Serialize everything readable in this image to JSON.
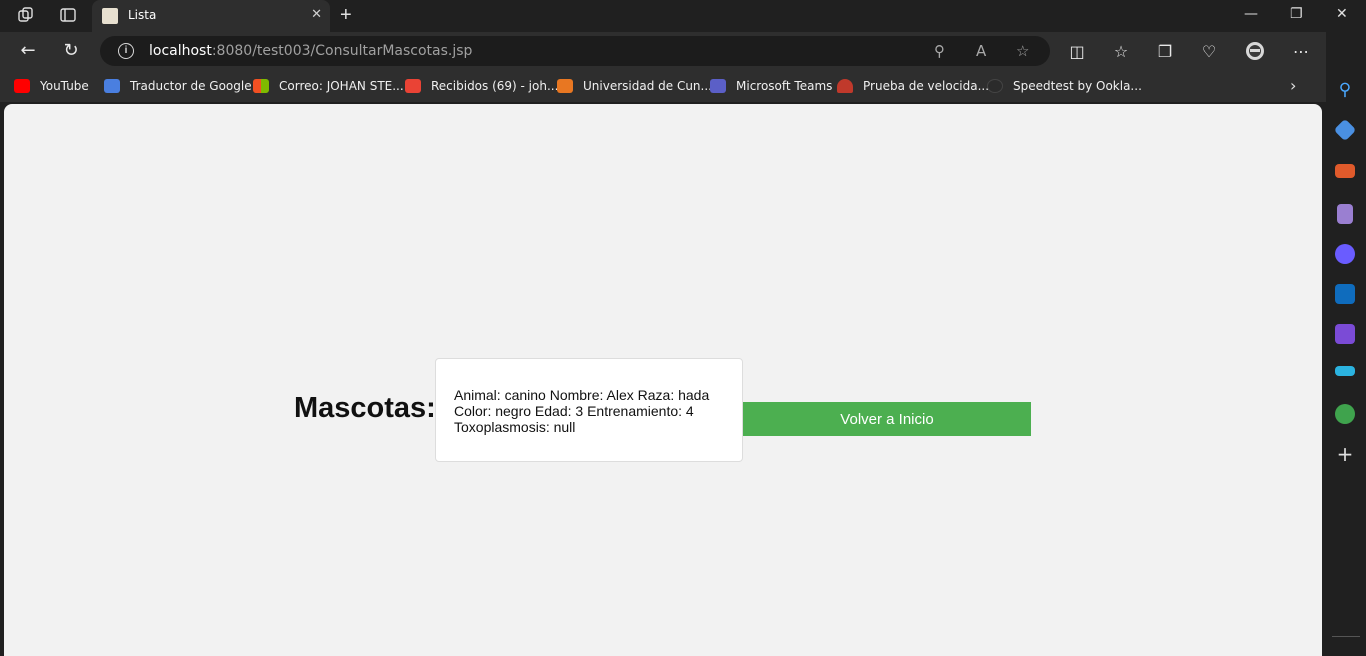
{
  "browser": {
    "tab": {
      "title": "Lista",
      "close": "✕"
    },
    "new_tab": "+",
    "window_controls": {
      "minimize": "—",
      "restore": "❐",
      "close": "✕"
    },
    "address": {
      "host": "localhost",
      "rest": ":8080/test003/ConsultarMascotas.jsp"
    },
    "bookmarks": [
      {
        "label": "YouTube",
        "color": "#ff0000"
      },
      {
        "label": "Traductor de Google",
        "color": "#4a7fe0"
      },
      {
        "label": "Correo: JOHAN STE...",
        "color": "#f25022"
      },
      {
        "label": "Recibidos (69) - joh...",
        "color": "#ea4335"
      },
      {
        "label": "Universidad de Cun...",
        "color": "#e87722"
      },
      {
        "label": "Microsoft Teams",
        "color": "#5b5fc7"
      },
      {
        "label": "Prueba de velocida...",
        "color": "#c0392b"
      },
      {
        "label": "Speedtest by Ookla...",
        "color": "#2b2b2b"
      }
    ],
    "sidebar_icons": [
      {
        "name": "search-icon",
        "color": "#4aa8ff"
      },
      {
        "name": "tag-icon",
        "color": "#4a90e2"
      },
      {
        "name": "briefcase-icon",
        "color": "#e05a2b"
      },
      {
        "name": "chess-icon",
        "color": "#9a7fd1"
      },
      {
        "name": "copilot-icon",
        "color": "#6a5cff"
      },
      {
        "name": "outlook-icon",
        "color": "#0f6cbd"
      },
      {
        "name": "designer-icon",
        "color": "#7b4bd6"
      },
      {
        "name": "send-icon",
        "color": "#2bb3e0"
      },
      {
        "name": "tree-icon",
        "color": "#3fa34d"
      },
      {
        "name": "add-icon",
        "color": "#e0e0e0"
      }
    ]
  },
  "page": {
    "heading": "Mascotas:",
    "record_text": "Animal: canino Nombre: Alex Raza: hada Color: negro Edad: 3 Entrenamiento: 4 Toxoplasmosis: null",
    "button_label": "Volver a Inicio"
  }
}
